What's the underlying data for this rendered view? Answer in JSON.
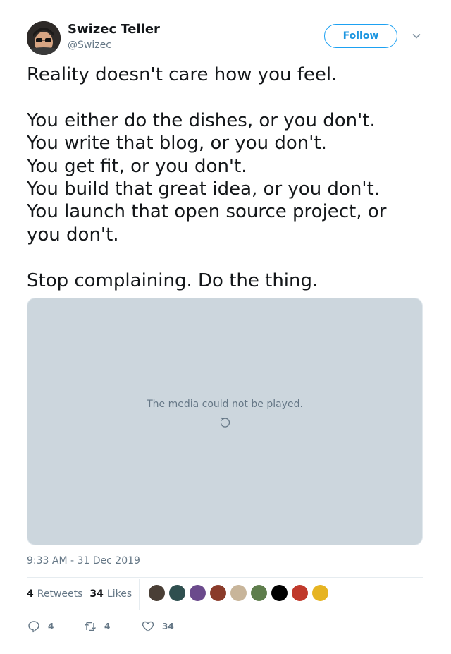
{
  "author": {
    "display_name": "Swizec Teller",
    "handle": "@Swizec"
  },
  "header": {
    "follow_label": "Follow",
    "menu_icon": "chevron-down-icon"
  },
  "tweet": {
    "text": "Reality doesn't care how you feel.\n\nYou either do the dishes, or you don't.\nYou write that blog, or you don't.\nYou get fit, or you don't.\nYou build that great idea, or you don't.\nYou launch that open source project, or you don't.\n\nStop complaining. Do the thing.",
    "timestamp": "9:33 AM - 31 Dec 2019"
  },
  "media": {
    "error_text": "The media could not be played.",
    "icon": "replay-icon"
  },
  "stats": {
    "retweets_count": "4",
    "retweets_label": "Retweets",
    "likes_count": "34",
    "likes_label": "Likes"
  },
  "likers": [
    "#4a3f36",
    "#2f4f4f",
    "#6b4a8c",
    "#8a3b2a",
    "#c8b59a",
    "#5e7d4c",
    "#000000",
    "#c0392b",
    "#e6b422"
  ],
  "actions": {
    "reply_count": "4",
    "retweet_count": "4",
    "like_count": "34"
  },
  "colors": {
    "accent": "#1da1f2",
    "secondary_text": "#657786",
    "media_bg": "#ccd6dd"
  }
}
